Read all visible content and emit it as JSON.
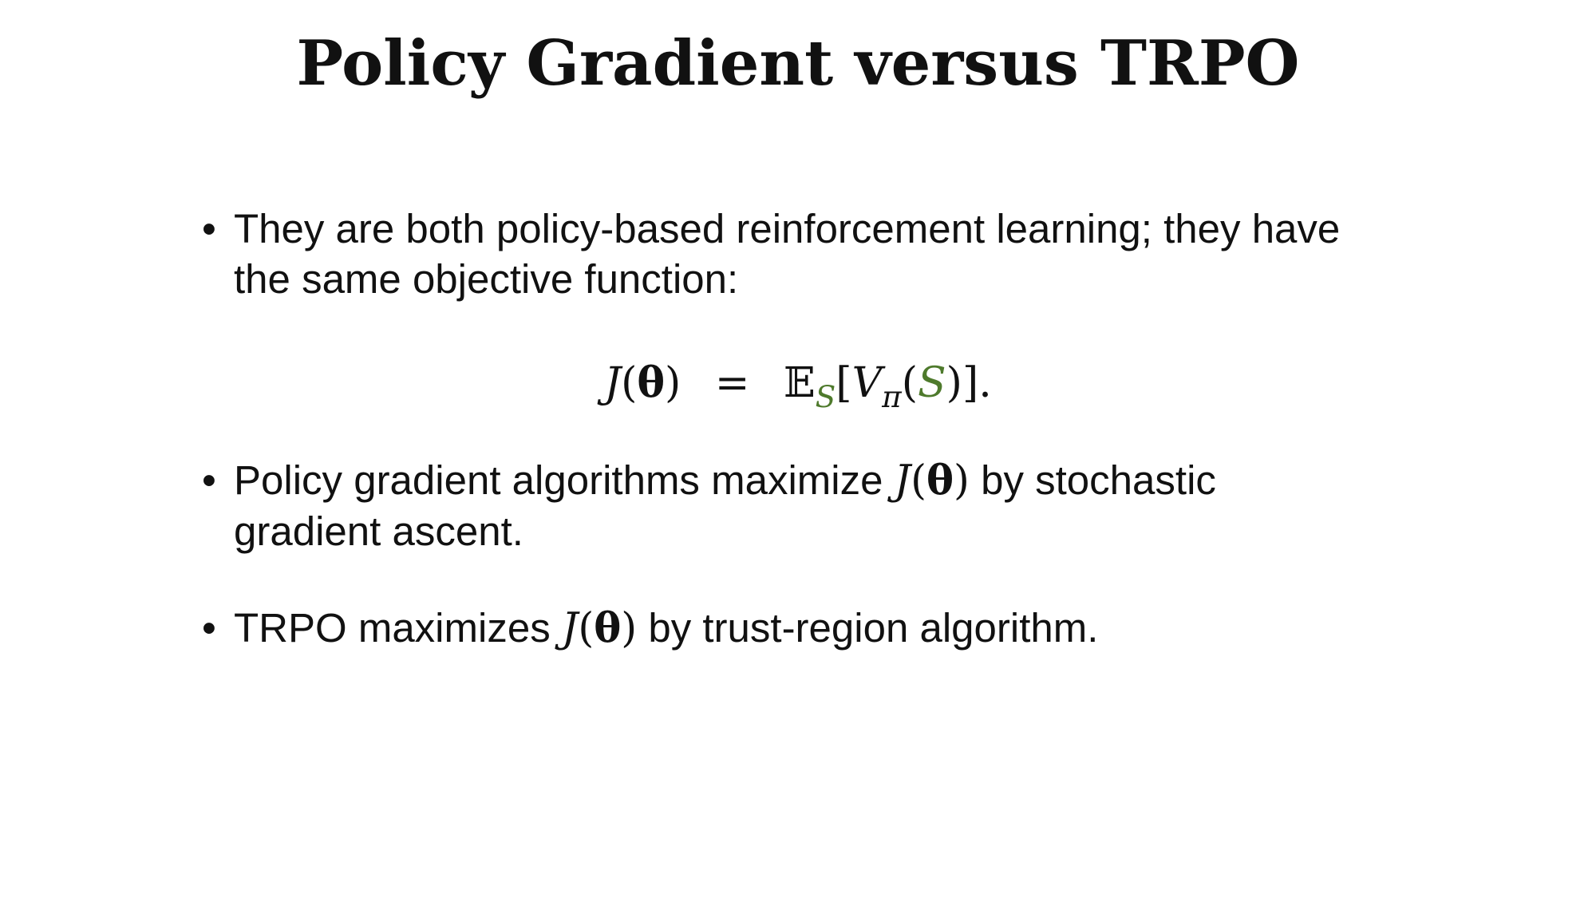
{
  "slide": {
    "title": "Policy Gradient versus TRPO"
  },
  "bullets": [
    {
      "marker": "•",
      "line1": "They are both policy-based reinforcement learning; they have",
      "line2": "the same objective function:"
    },
    {
      "marker": "•",
      "before": "Policy gradient algorithms maximize",
      "after": "by stochastic",
      "line2": "gradient ascent."
    },
    {
      "marker": "•",
      "before": "TRPO maximizes",
      "after": "by trust-region algorithm."
    }
  ],
  "math": {
    "J": "J",
    "open": "(",
    "theta": "θ",
    "close": ")",
    "equals": "=",
    "E": "𝔼",
    "S": "S",
    "lbracket": "[",
    "V": "V",
    "pi": "π",
    "rbracket": "]",
    "period": "."
  },
  "colors": {
    "accent_green": "#4e7a2c",
    "text": "#111111",
    "background": "#ffffff"
  }
}
